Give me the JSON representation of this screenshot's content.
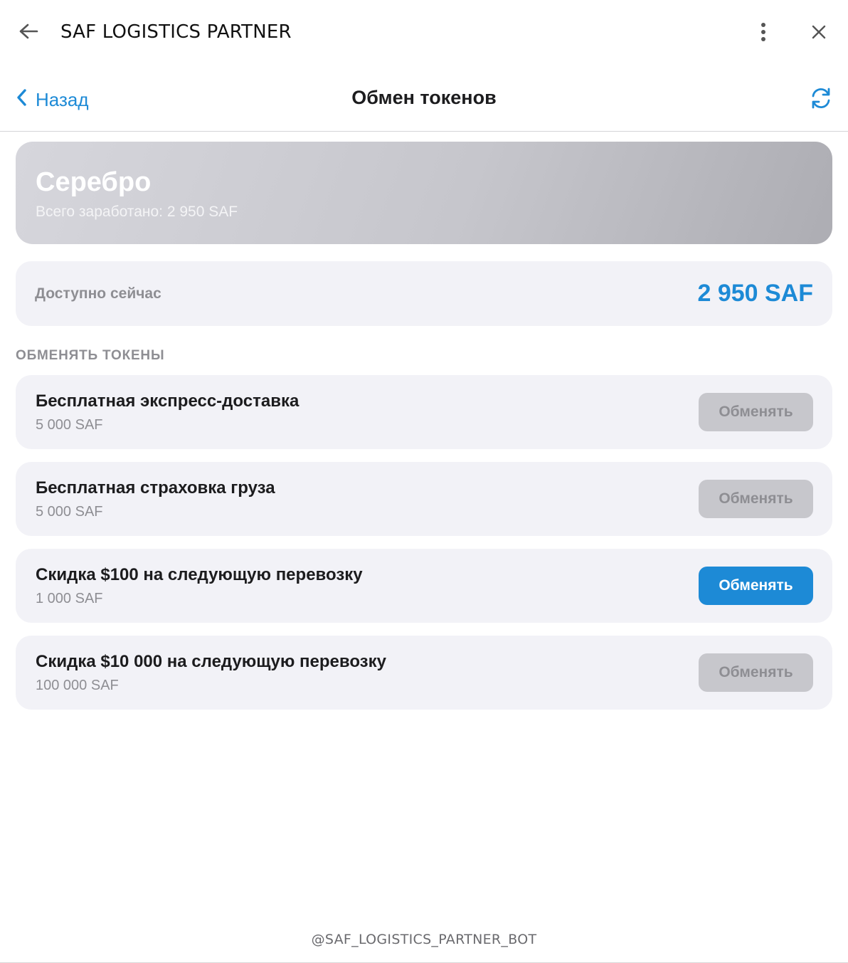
{
  "window": {
    "title": "SAF LOGISTICS PARTNER"
  },
  "header": {
    "back_label": "Назад",
    "title": "Обмен токенов"
  },
  "tier": {
    "name": "Серебро",
    "earned": "Всего заработано: 2 950 SAF"
  },
  "balance": {
    "label": "Доступно сейчас",
    "value": "2 950 SAF"
  },
  "section": {
    "label": "ОБМЕНЯТЬ ТОКЕНЫ"
  },
  "rewards": [
    {
      "title": "Бесплатная экспресс-доставка",
      "cost": "5 000 SAF",
      "button": "Обменять",
      "enabled": false
    },
    {
      "title": "Бесплатная страховка груза",
      "cost": "5 000 SAF",
      "button": "Обменять",
      "enabled": false
    },
    {
      "title": "Скидка $100 на следующую перевозку",
      "cost": "1 000 SAF",
      "button": "Обменять",
      "enabled": true
    },
    {
      "title": "Скидка $10 000 на следующую перевозку",
      "cost": "100 000 SAF",
      "button": "Обменять",
      "enabled": false
    }
  ],
  "footer": {
    "bot_handle": "@SAF_LOGISTICS_PARTNER_BOT"
  },
  "colors": {
    "accent": "#1d8ad6",
    "card_bg": "#f2f2f7",
    "disabled_button": "#c7c7cc",
    "muted_text": "#8e8e93"
  },
  "icons": {
    "window_back": "arrow-left-icon",
    "menu": "more-vertical-icon",
    "close": "close-icon",
    "nav_back": "chevron-left-icon",
    "refresh": "refresh-icon"
  }
}
